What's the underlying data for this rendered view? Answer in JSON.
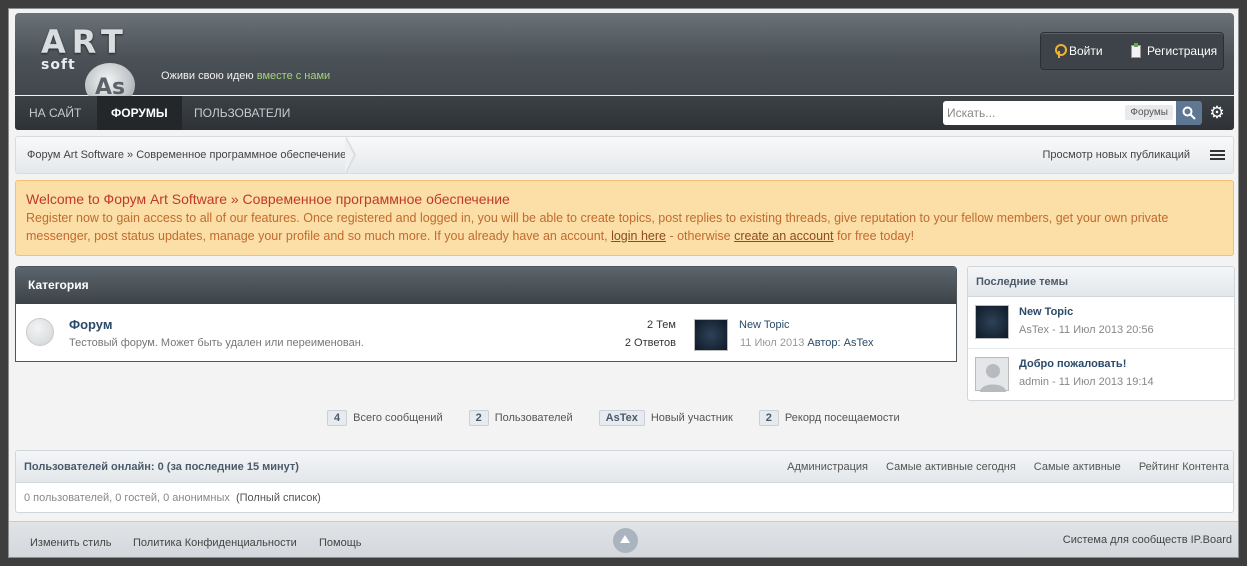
{
  "logo": {
    "art": "ART",
    "soft": "soft",
    "mark": "As"
  },
  "tagline": {
    "text": "Оживи свою идею",
    "highlight": "вместе с нами"
  },
  "auth": {
    "login": "Войти",
    "register": "Регистрация"
  },
  "nav": {
    "items": [
      "На сайт",
      "Форумы",
      "Пользователи"
    ],
    "active": "Форумы"
  },
  "search": {
    "placeholder": "Искать...",
    "scope": "Форумы"
  },
  "breadcrumb": {
    "path": "Форум Art Software » Современное программное обеспечение",
    "new_posts": "Просмотр новых публикаций"
  },
  "welcome": {
    "title": "Welcome to Форум Art Software » Современное программное обеспечение",
    "text_1": "Register now to gain access to all of our features. Once registered and logged in, you will be able to create topics, post replies to existing threads, give reputation to your fellow members, get your own private messenger, post status updates, manage your profile and so much more. If you already have an account,",
    "login_link": "login here",
    "text_2": "- otherwise",
    "create_link": "create an account",
    "text_3": "for free today!"
  },
  "category": {
    "header": "Категория",
    "forum": {
      "name": "Форум",
      "description": "Тестовый форум. Может быть удален или переименован.",
      "topics": "2 Тем",
      "replies": "2 Ответов",
      "last_topic": "New Topic",
      "last_date": "11 Июл 2013",
      "last_author": "Автор: AsTex"
    }
  },
  "sidebar": {
    "title": "Последние темы",
    "items": [
      {
        "title": "New Topic",
        "meta": "AsTex - 11 Июл 2013 20:56"
      },
      {
        "title": "Добро пожаловать!",
        "meta": "admin - 11 Июл 2013 19:14"
      }
    ]
  },
  "stats": [
    {
      "value": "4",
      "label": "Всего сообщений"
    },
    {
      "value": "2",
      "label": "Пользователей"
    },
    {
      "value": "AsTex",
      "label": "Новый участник"
    },
    {
      "value": "2",
      "label": "Рекорд посещаемости"
    }
  ],
  "online": {
    "title": "Пользователей онлайн: 0 (за последние 15 минут)",
    "links": [
      "Администрация",
      "Самые активные сегодня",
      "Самые активные",
      "Рейтинг Контента"
    ],
    "summary": "0 пользователей, 0 гостей, 0 анонимных",
    "full_list": "(Полный список)"
  },
  "footer": {
    "links": [
      "Изменить стиль",
      "Политика Конфиденциальности",
      "Помощь"
    ],
    "powered": "Система для сообществ IP.Board"
  }
}
